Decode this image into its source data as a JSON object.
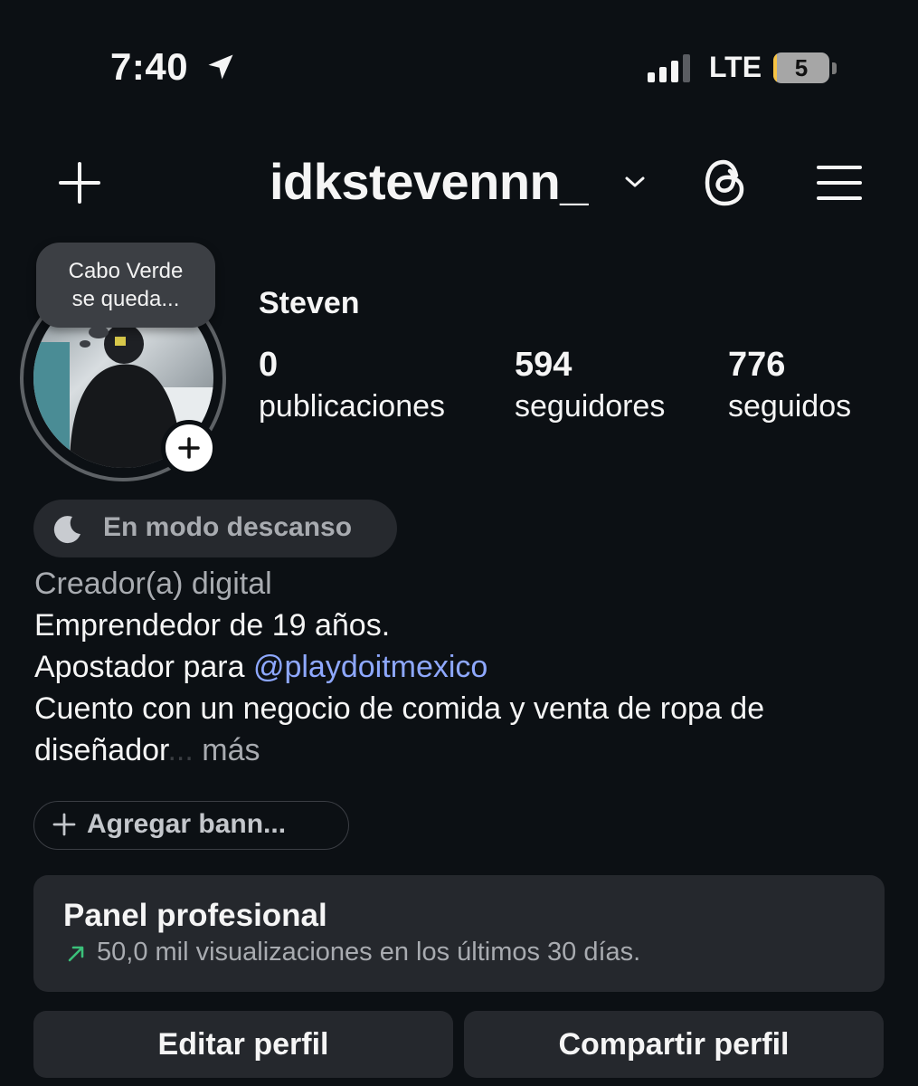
{
  "status_bar": {
    "time": "7:40",
    "network": "LTE",
    "battery_level": "5",
    "battery_fraction": 0.05,
    "location_icon": "location-arrow-icon",
    "signal_icon": "cellular-signal-icon"
  },
  "header": {
    "username": "idkstevennn_",
    "icons": [
      "plus-icon",
      "chevron-down-icon",
      "threads-icon",
      "menu-icon"
    ]
  },
  "profile": {
    "note": "Cabo Verde se queda...",
    "name": "Steven",
    "stats": [
      {
        "count": "0",
        "label": "publicaciones"
      },
      {
        "count": "594",
        "label": "seguidores"
      },
      {
        "count": "776",
        "label": "seguidos"
      }
    ]
  },
  "status_chip": {
    "icon": "moon-icon",
    "label": "En modo descanso"
  },
  "bio": {
    "category": "Creador(a) digital",
    "line1": "Emprendedor de 19 años.",
    "line2_prefix": "Apostador para ",
    "line2_mention": "@playdoitmexico",
    "line3": "Cuento con un negocio de comida y venta de ropa de",
    "line4": "diseñador",
    "ellipsis": "...",
    "more": " más"
  },
  "banner_button": {
    "label": "Agregar bann..."
  },
  "professional_panel": {
    "title": "Panel profesional",
    "subtitle": "50,0 mil visualizaciones en los últimos 30 días."
  },
  "buttons": {
    "edit": "Editar perfil",
    "share": "Compartir perfil"
  },
  "colors": {
    "background": "#0c1014",
    "surface": "#25282d",
    "mention": "#8ea8ff",
    "muted": "#a8abb0",
    "trend_up": "#3bc07a",
    "battery": "#f6c344"
  }
}
